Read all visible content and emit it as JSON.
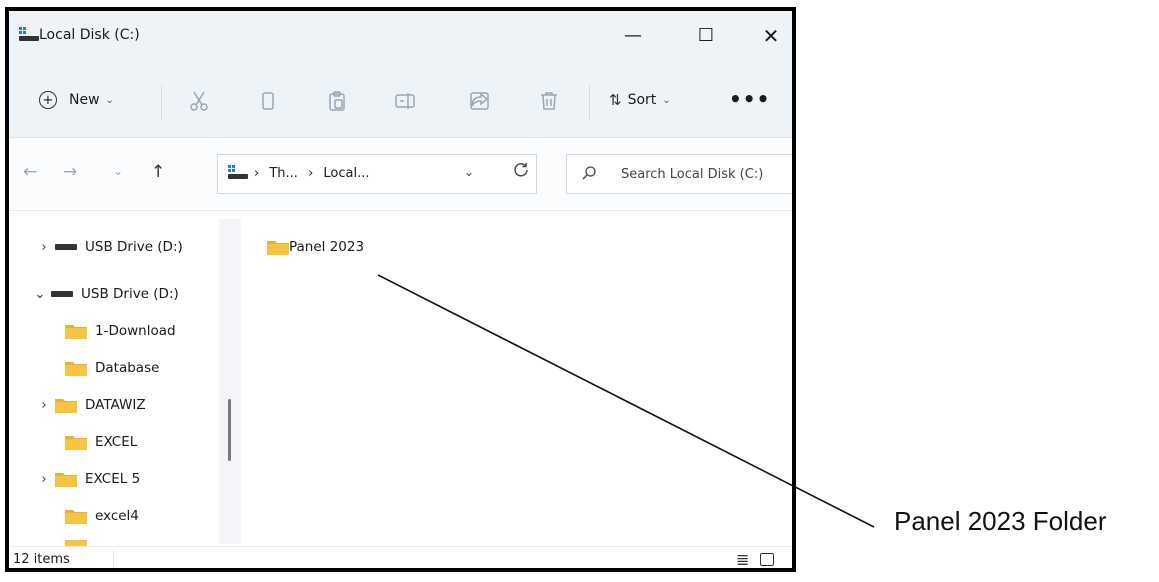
{
  "window": {
    "title": "Local Disk (C:)",
    "controls": {
      "minimize": "—",
      "maximize": "☐",
      "close": "✕"
    }
  },
  "toolbar": {
    "new_label": "New",
    "sort_label": "Sort",
    "more_label": "•••",
    "icons": [
      "cut-icon",
      "copy-icon",
      "paste-icon",
      "rename-icon",
      "share-icon",
      "delete-icon"
    ]
  },
  "nav": {
    "back": "←",
    "forward": "→",
    "recent": "⌄",
    "up": "↑",
    "breadcrumbs": [
      "›",
      "Th...",
      "›",
      "Local..."
    ],
    "dropdown": "⌄",
    "refresh": "C",
    "search_placeholder": "Search Local Disk (C:)"
  },
  "sidebar": {
    "items": [
      {
        "label": "USB Drive (D:)",
        "chevron": "›",
        "type": "drive"
      },
      {
        "label": "USB Drive (D:)",
        "chevron": "⌄",
        "type": "drive"
      },
      {
        "label": "1-Download",
        "chevron": "",
        "type": "folder"
      },
      {
        "label": "Database",
        "chevron": "",
        "type": "folder"
      },
      {
        "label": "DATAWIZ",
        "chevron": "›",
        "type": "folder"
      },
      {
        "label": "EXCEL",
        "chevron": "",
        "type": "folder"
      },
      {
        "label": "EXCEL 5",
        "chevron": "›",
        "type": "folder"
      },
      {
        "label": "excel4",
        "chevron": "",
        "type": "folder"
      }
    ]
  },
  "content": {
    "items": [
      {
        "label": "Panel 2023",
        "type": "folder"
      }
    ]
  },
  "status": {
    "count": "12 items",
    "details_view": "≣"
  },
  "annotation": {
    "label": "Panel 2023 Folder"
  },
  "colors": {
    "folder": "#f5c443",
    "window_bg": "#eef3f8",
    "border": "#000000"
  }
}
